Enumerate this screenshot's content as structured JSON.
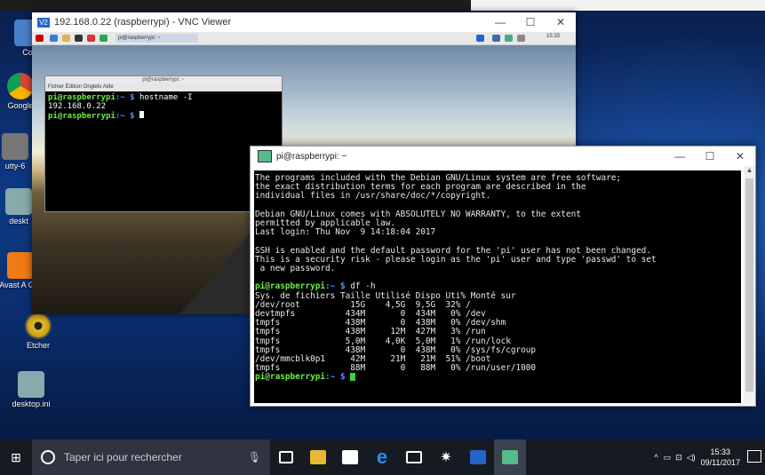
{
  "desktop": {
    "icons": [
      {
        "label": "Co"
      },
      {
        "label": "Google"
      },
      {
        "label": "utty-6"
      },
      {
        "label": "deskt"
      },
      {
        "label": "Avast A Gra"
      },
      {
        "label": "Etcher"
      },
      {
        "label": "desktop.ini"
      }
    ]
  },
  "vnc": {
    "title": "192.168.0.22 (raspberrypi) - VNC Viewer",
    "logo": "V2",
    "controls": {
      "minimize": "—",
      "maximize": "☐",
      "close": "✕"
    },
    "toolbar": {
      "tab_label": "pi@raspberrypi: ~",
      "clock": "15:33"
    },
    "pi_terminal": {
      "menu": "Fichier  Édition  Onglets  Aide",
      "title": "pi@raspberrypi: ~",
      "prompt_user": "pi@raspberrypi",
      "prompt_path": ":~ $",
      "command": " hostname -I",
      "output": "192.168.0.22"
    }
  },
  "putty": {
    "title": "pi@raspberrypi: ~",
    "controls": {
      "minimize": "—",
      "maximize": "☐",
      "close": "✕"
    },
    "motd": [
      "The programs included with the Debian GNU/Linux system are free software;",
      "the exact distribution terms for each program are described in the",
      "individual files in /usr/share/doc/*/copyright.",
      "",
      "Debian GNU/Linux comes with ABSOLUTELY NO WARRANTY, to the extent",
      "permitted by applicable law.",
      "Last login: Thu Nov  9 14:18:04 2017",
      "",
      "SSH is enabled and the default password for the 'pi' user has not been changed.",
      "This is a security risk - please login as the 'pi' user and type 'passwd' to set",
      " a new password.",
      ""
    ],
    "prompt_user": "pi@raspberrypi",
    "prompt_path": ":~ $",
    "command": " df -h",
    "df_header": "Sys. de fichiers Taille Utilisé Dispo Uti% Monté sur",
    "df_rows": [
      "/dev/root          15G    4,5G  9,5G  32% /",
      "devtmpfs          434M       0  434M   0% /dev",
      "tmpfs             438M       0  438M   0% /dev/shm",
      "tmpfs             438M     12M  427M   3% /run",
      "tmpfs             5,0M    4,0K  5,0M   1% /run/lock",
      "tmpfs             438M       0  438M   0% /sys/fs/cgroup",
      "/dev/mmcblk0p1     42M     21M   21M  51% /boot",
      "tmpfs              88M       0   88M   0% /run/user/1000"
    ]
  },
  "taskbar": {
    "search_placeholder": "Taper ici pour rechercher",
    "time": "15:33",
    "date": "09/11/2017"
  }
}
